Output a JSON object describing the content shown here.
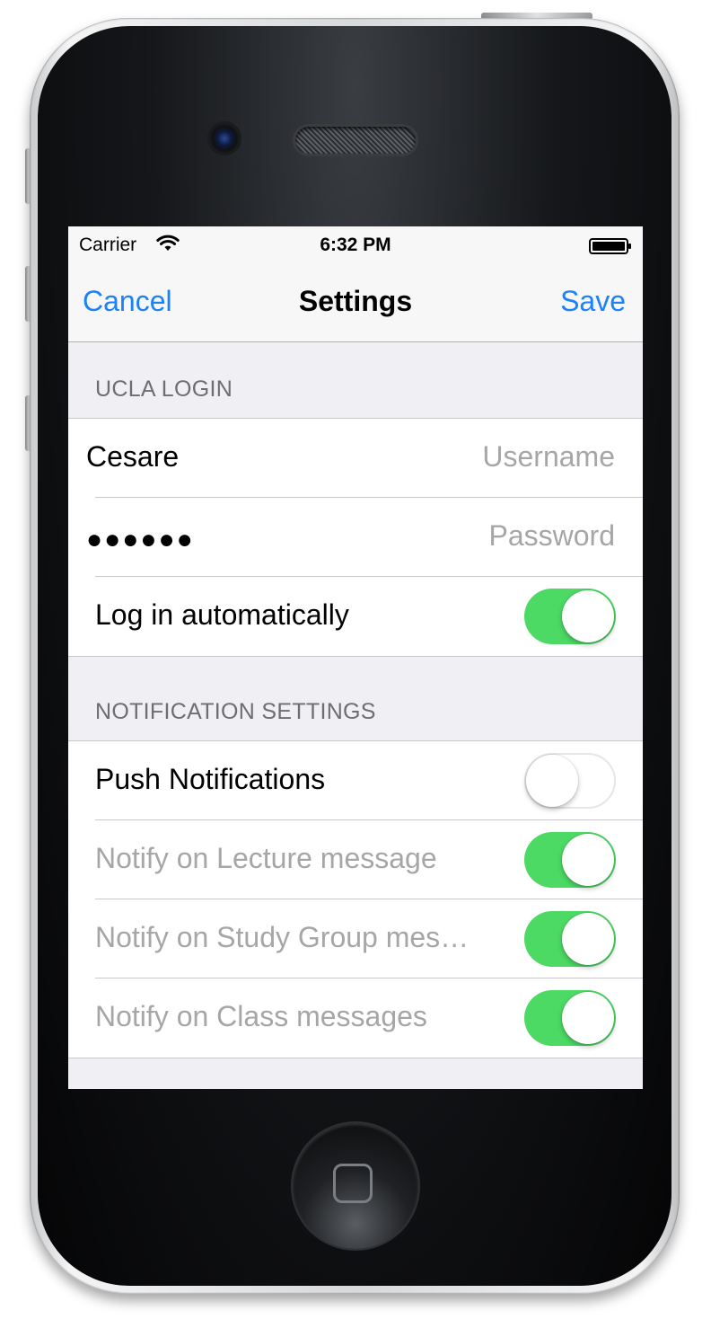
{
  "status_bar": {
    "carrier": "Carrier",
    "time": "6:32 PM",
    "wifi_icon": "wifi-icon",
    "battery_icon": "battery-full-icon"
  },
  "nav": {
    "cancel_label": "Cancel",
    "title": "Settings",
    "save_label": "Save",
    "tint_color": "#1a82fb"
  },
  "login_section": {
    "header": "UCLA LOGIN",
    "username_value": "Cesare",
    "username_placeholder": "Username",
    "password_masked": "●●●●●●",
    "password_placeholder": "Password",
    "auto_login_label": "Log in automatically",
    "auto_login_on": true
  },
  "notification_section": {
    "header": "NOTIFICATION SETTINGS",
    "push_label": "Push Notifications",
    "push_on": false,
    "items": [
      {
        "label": "Notify on Lecture message",
        "on": true,
        "enabled": false
      },
      {
        "label": "Notify on Study Group mes…",
        "on": true,
        "enabled": false
      },
      {
        "label": "Notify on Class messages",
        "on": true,
        "enabled": false
      }
    ]
  },
  "colors": {
    "switch_on": "#4cd964",
    "background": "#efeff4"
  }
}
